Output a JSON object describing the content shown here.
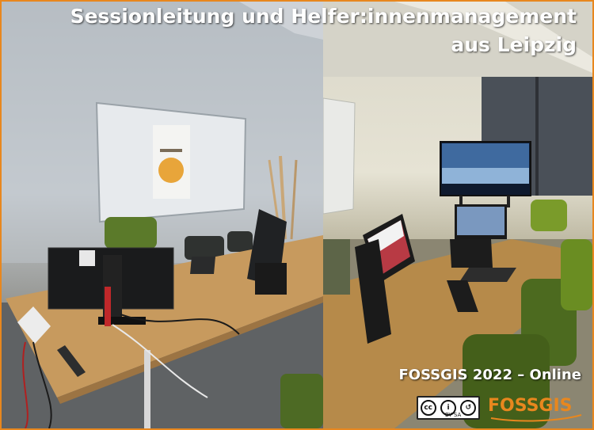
{
  "header": {
    "line1": "Sessionleitung und Helfer:innenmanagement",
    "line2": "aus Leipzig"
  },
  "footer": {
    "event": "FOSSGIS 2022 – Online"
  },
  "license": {
    "text": "BY SA"
  },
  "logo": {
    "text": "FOSSGIS",
    "color": "#e8871e"
  },
  "colors": {
    "border": "#e8871e",
    "title": "#ffffff"
  }
}
